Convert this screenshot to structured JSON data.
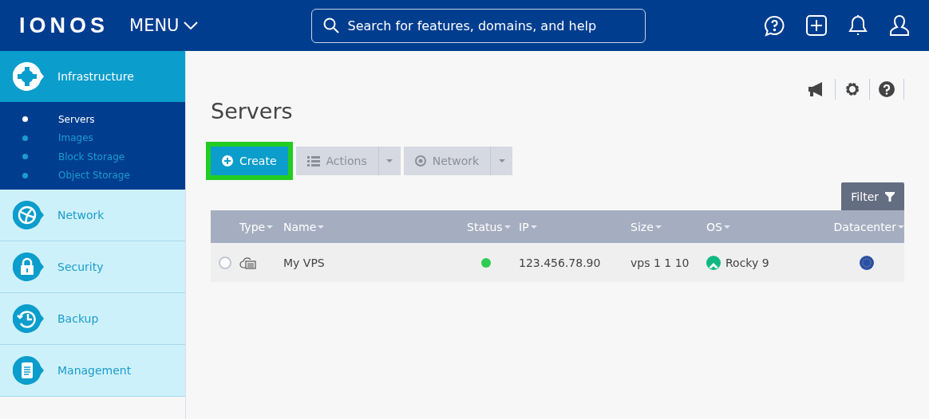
{
  "header": {
    "logo": "IONOS",
    "menu": "MENU",
    "search": {
      "placeholder": "Search for features, domains, and help"
    }
  },
  "sidebar": {
    "sections": [
      {
        "label": "Infrastructure",
        "kind": "infrastructure",
        "selected": true,
        "children": [
          {
            "label": "Servers",
            "selected": true
          },
          {
            "label": "Images",
            "selected": false
          },
          {
            "label": "Block Storage",
            "selected": false
          },
          {
            "label": "Object Storage",
            "selected": false
          }
        ]
      },
      {
        "label": "Network",
        "kind": "network",
        "selected": false
      },
      {
        "label": "Security",
        "kind": "security",
        "selected": false
      },
      {
        "label": "Backup",
        "kind": "backup",
        "selected": false
      },
      {
        "label": "Management",
        "kind": "management",
        "selected": false
      }
    ]
  },
  "page": {
    "title": "Servers",
    "toolbar": [
      {
        "label": "Create",
        "kind": "create",
        "highlighted": true,
        "disabled": false
      },
      {
        "label": "Actions",
        "kind": "actions",
        "highlighted": false,
        "disabled": true
      },
      {
        "label": "Network",
        "kind": "network",
        "highlighted": false,
        "disabled": true
      }
    ],
    "filter": "Filter",
    "table": {
      "columns": [
        "Type",
        "Name",
        "Status",
        "IP",
        "Size",
        "OS",
        "Datacenter"
      ],
      "rows": [
        {
          "selected": false,
          "name": "My VPS",
          "online": true,
          "ip": "123.456.78.90",
          "size": "vps 1 1 10",
          "os": "Rocky 9"
        }
      ]
    }
  }
}
